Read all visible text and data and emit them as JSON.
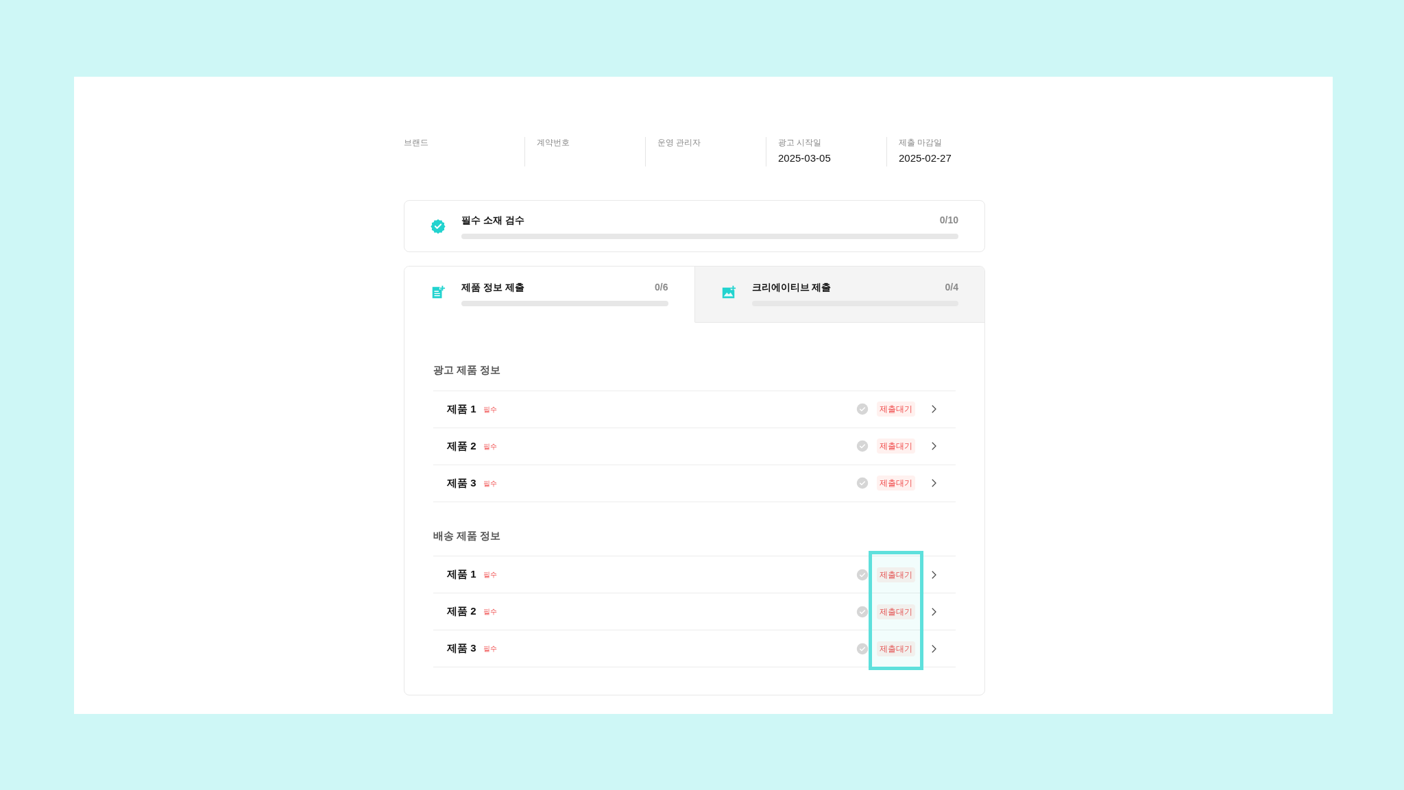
{
  "info_fields": [
    {
      "label": "브랜드"
    },
    {
      "label": "계약번호"
    },
    {
      "label": "운영 관리자"
    },
    {
      "label": "광고 시작일",
      "value": "2025-03-05"
    },
    {
      "label": "제출 마감일",
      "value": "2025-02-27"
    }
  ],
  "review": {
    "title": "필수 소재 검수",
    "count": "0/10"
  },
  "tabs": [
    {
      "kind": "document",
      "title": "제품 정보 제출",
      "count": "0/6",
      "selected": true
    },
    {
      "kind": "image",
      "title": "크리에이티브 제출",
      "count": "0/4",
      "selected": false
    }
  ],
  "sections": [
    {
      "title": "광고 제품 정보",
      "highlighted": false,
      "items": [
        {
          "name": "제품 1",
          "tag": "필수",
          "done": false,
          "status": "제출대기"
        },
        {
          "name": "제품 2",
          "tag": "필수",
          "done": false,
          "status": "제출대기"
        },
        {
          "name": "제품 3",
          "tag": "필수",
          "done": false,
          "status": "제출대기"
        }
      ]
    },
    {
      "title": "배송 제품 정보",
      "highlighted": true,
      "items": [
        {
          "name": "제품 1",
          "tag": "필수",
          "done": false,
          "status": "제출대기"
        },
        {
          "name": "제품 2",
          "tag": "필수",
          "done": false,
          "status": "제출대기"
        },
        {
          "name": "제품 3",
          "tag": "필수",
          "done": false,
          "status": "제출대기"
        }
      ]
    }
  ]
}
